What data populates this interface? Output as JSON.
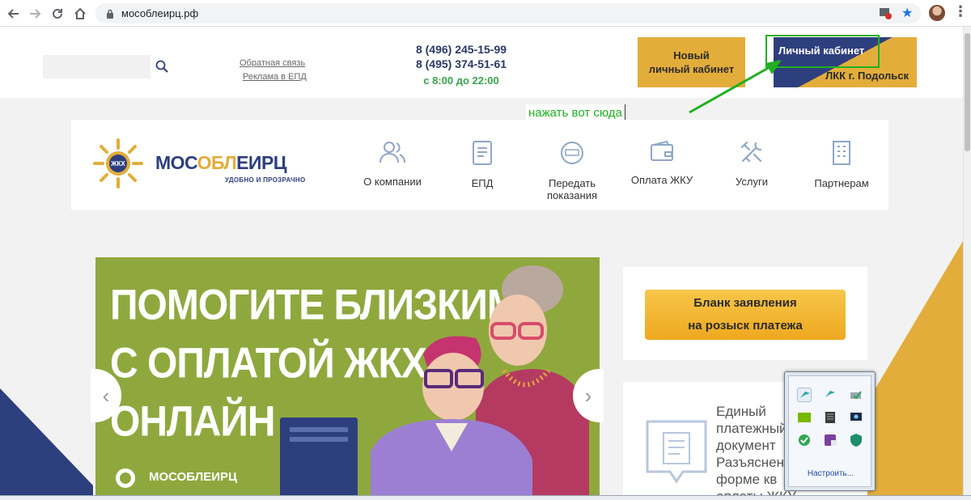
{
  "browser": {
    "url": "мособлеирц.рф",
    "icons": [
      "back-icon",
      "forward-icon",
      "reload-icon",
      "home-icon",
      "lock-icon",
      "star-icon",
      "profile-avatar",
      "menu-dots-icon"
    ]
  },
  "header": {
    "feedback_link": "Обратная связь",
    "ads_link": "Реклама в ЕПД",
    "phone_1": "8 (496) 245-15-99",
    "phone_2": "8 (495) 374-51-61",
    "hours": "с 8:00 до 22:00",
    "new_cabinet_line1": "Новый",
    "new_cabinet_line2": "личный кабинет",
    "cabinet_label": "Личный кабинет",
    "cabinet_sub": "ЛКК г. Подольск"
  },
  "annotation": {
    "text": "нажать вот сюда",
    "color": "#21b021"
  },
  "logo": {
    "name_part1": "МОС",
    "name_part2": "ОБЛ",
    "name_part3": "ЕИРЦ",
    "badge": "ЖКХ",
    "tagline": "УДОБНО И ПРОЗРАЧНО"
  },
  "nav": {
    "items": [
      {
        "label": "О компании",
        "icon": "people-icon"
      },
      {
        "label": "ЕПД",
        "icon": "document-icon"
      },
      {
        "label": "Передать показания",
        "icon": "meter-icon"
      },
      {
        "label": "Оплата ЖКУ",
        "icon": "wallet-icon"
      },
      {
        "label": "Услуги",
        "icon": "tools-icon"
      },
      {
        "label": "Партнерам",
        "icon": "building-icon"
      }
    ]
  },
  "banner": {
    "line1": "ПОМОГИТЕ БЛИЗКИМ",
    "line2": "С ОПЛАТОЙ ЖКХ",
    "line3": "ОНЛАЙН",
    "logo_text": "МОСОБЛЕИРЦ",
    "prev": "‹",
    "next": "›"
  },
  "sidebar": {
    "blank_line1": "Бланк заявления",
    "blank_line2": "на розыск платежа",
    "epd_line1": "Единый",
    "epd_line2": "платежный",
    "epd_line3": "документ",
    "epd_line4": "Разъяснение",
    "epd_line5": "форме кв",
    "epd_line6": "оплаты ЖКУ"
  },
  "tray": {
    "customize": "Настроить..."
  },
  "colors": {
    "brand_blue": "#2e3f7e",
    "brand_yellow": "#e3ad3b",
    "green": "#39a34b",
    "banner_green": "#8fa83e"
  }
}
